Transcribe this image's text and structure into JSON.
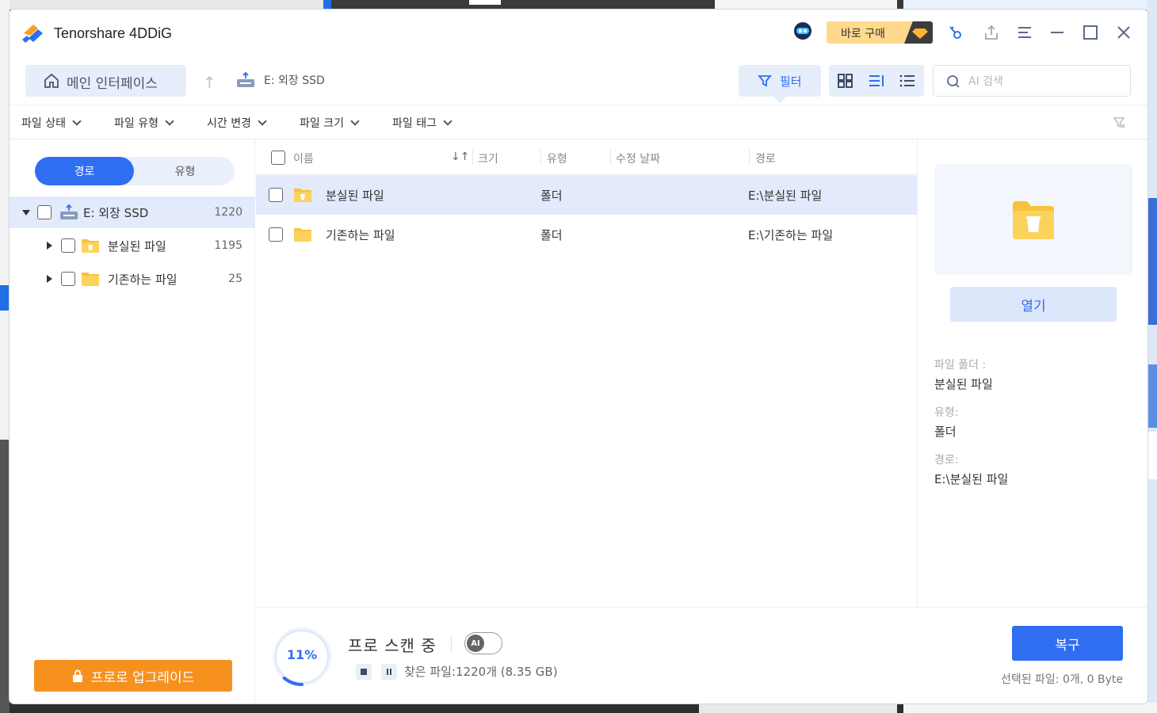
{
  "app": {
    "title": "Tenorshare 4DDiG",
    "buy_label": "바로 구매"
  },
  "navbar": {
    "home_label": "메인 인터페이스",
    "drive_label": "E: 외장 SSD",
    "filter_label": "필터",
    "search_placeholder": "AI 검색"
  },
  "filters": [
    {
      "label": "파일 상태"
    },
    {
      "label": "파일 유형"
    },
    {
      "label": "시간 변경"
    },
    {
      "label": "파일 크기"
    },
    {
      "label": "파일 태그"
    }
  ],
  "sidebar": {
    "tabs": [
      "경로",
      "유형"
    ],
    "active_tab": "경로",
    "tree": [
      {
        "label": "E: 외장 SSD",
        "count": "1220",
        "icon": "drive-icon"
      },
      {
        "label": "분실된 파일",
        "count": "1195",
        "icon": "lost-folder-icon"
      },
      {
        "label": "기존하는 파일",
        "count": "25",
        "icon": "folder-icon"
      }
    ],
    "upgrade_label": "프로로 업그레이드"
  },
  "table": {
    "headers": {
      "name": "이름",
      "size": "크기",
      "type": "유형",
      "modified": "수정 날짜",
      "path": "경로"
    },
    "rows": [
      {
        "name": "분실된 파일",
        "size": "",
        "type": "폴더",
        "modified": "",
        "path": "E:\\분실된 파일"
      },
      {
        "name": "기존하는 파일",
        "size": "",
        "type": "폴더",
        "modified": "",
        "path": "E:\\기존하는 파일"
      }
    ]
  },
  "details": {
    "open_label": "열기",
    "folder_label": "파일 폴더 :",
    "folder_value": "분실된 파일",
    "type_label": "유형:",
    "type_value": "폴더",
    "path_label": "경로:",
    "path_value": "E:\\분실된 파일"
  },
  "status": {
    "progress_text": "11%",
    "progress_value": 0.11,
    "scan_label": "프로 스캔 중",
    "ai_label": "AI",
    "found_text": "찾은 파일:1220개 (8.35 GB)",
    "recover_label": "복구",
    "selected_text": "선택된 파일: 0개, 0 Byte"
  },
  "colors": {
    "accent": "#2f6ef0",
    "upgrade": "#f6911f",
    "selection": "#e2eafb",
    "folder": "#f9c23c"
  }
}
